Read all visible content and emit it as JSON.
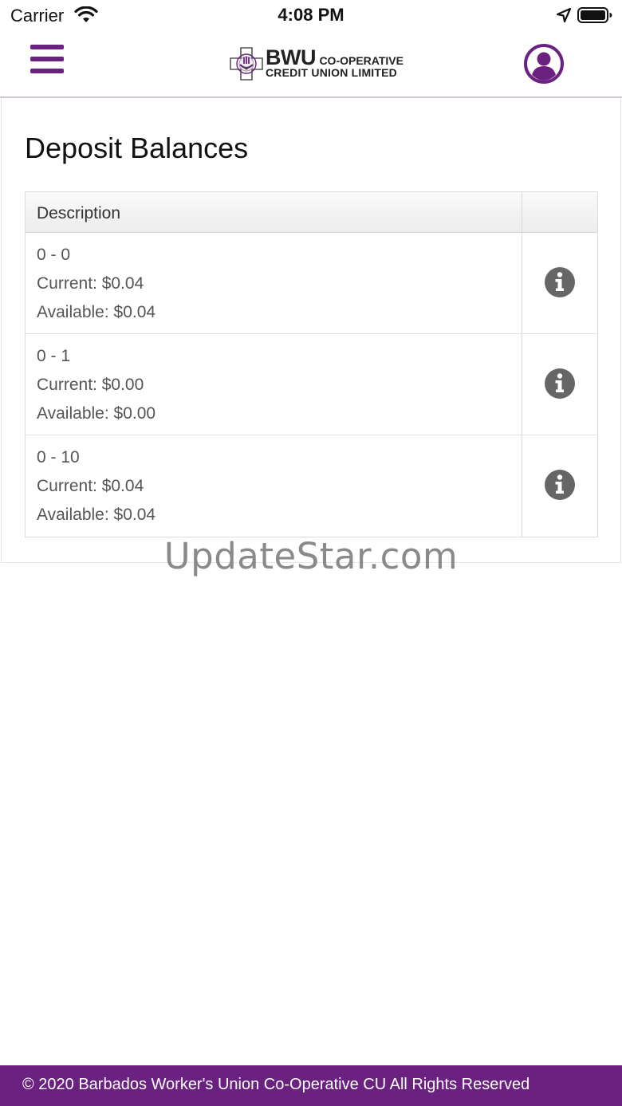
{
  "status_bar": {
    "carrier": "Carrier",
    "time": "4:08 PM"
  },
  "header": {
    "logo": {
      "brand": "BWU",
      "brand_suffix": "CO-OPERATIVE",
      "subtitle": "CREDIT UNION LIMITED"
    },
    "menu_icon": "hamburger-menu-icon",
    "profile_icon": "user-profile-icon",
    "accent_color": "#6b2180"
  },
  "page": {
    "title": "Deposit Balances"
  },
  "table": {
    "columns": [
      "Description",
      ""
    ],
    "rows": [
      {
        "account": "0 - 0",
        "current": "Current: $0.04",
        "available": "Available: $0.04"
      },
      {
        "account": "0 - 1",
        "current": "Current: $0.00",
        "available": "Available: $0.00"
      },
      {
        "account": "0 - 10",
        "current": "Current: $0.04",
        "available": "Available: $0.04"
      }
    ],
    "row_action_icon": "info-icon"
  },
  "watermark": "UpdateStar.com",
  "footer": {
    "text": "© 2020 Barbados Worker's Union Co-Operative CU All Rights Reserved"
  }
}
